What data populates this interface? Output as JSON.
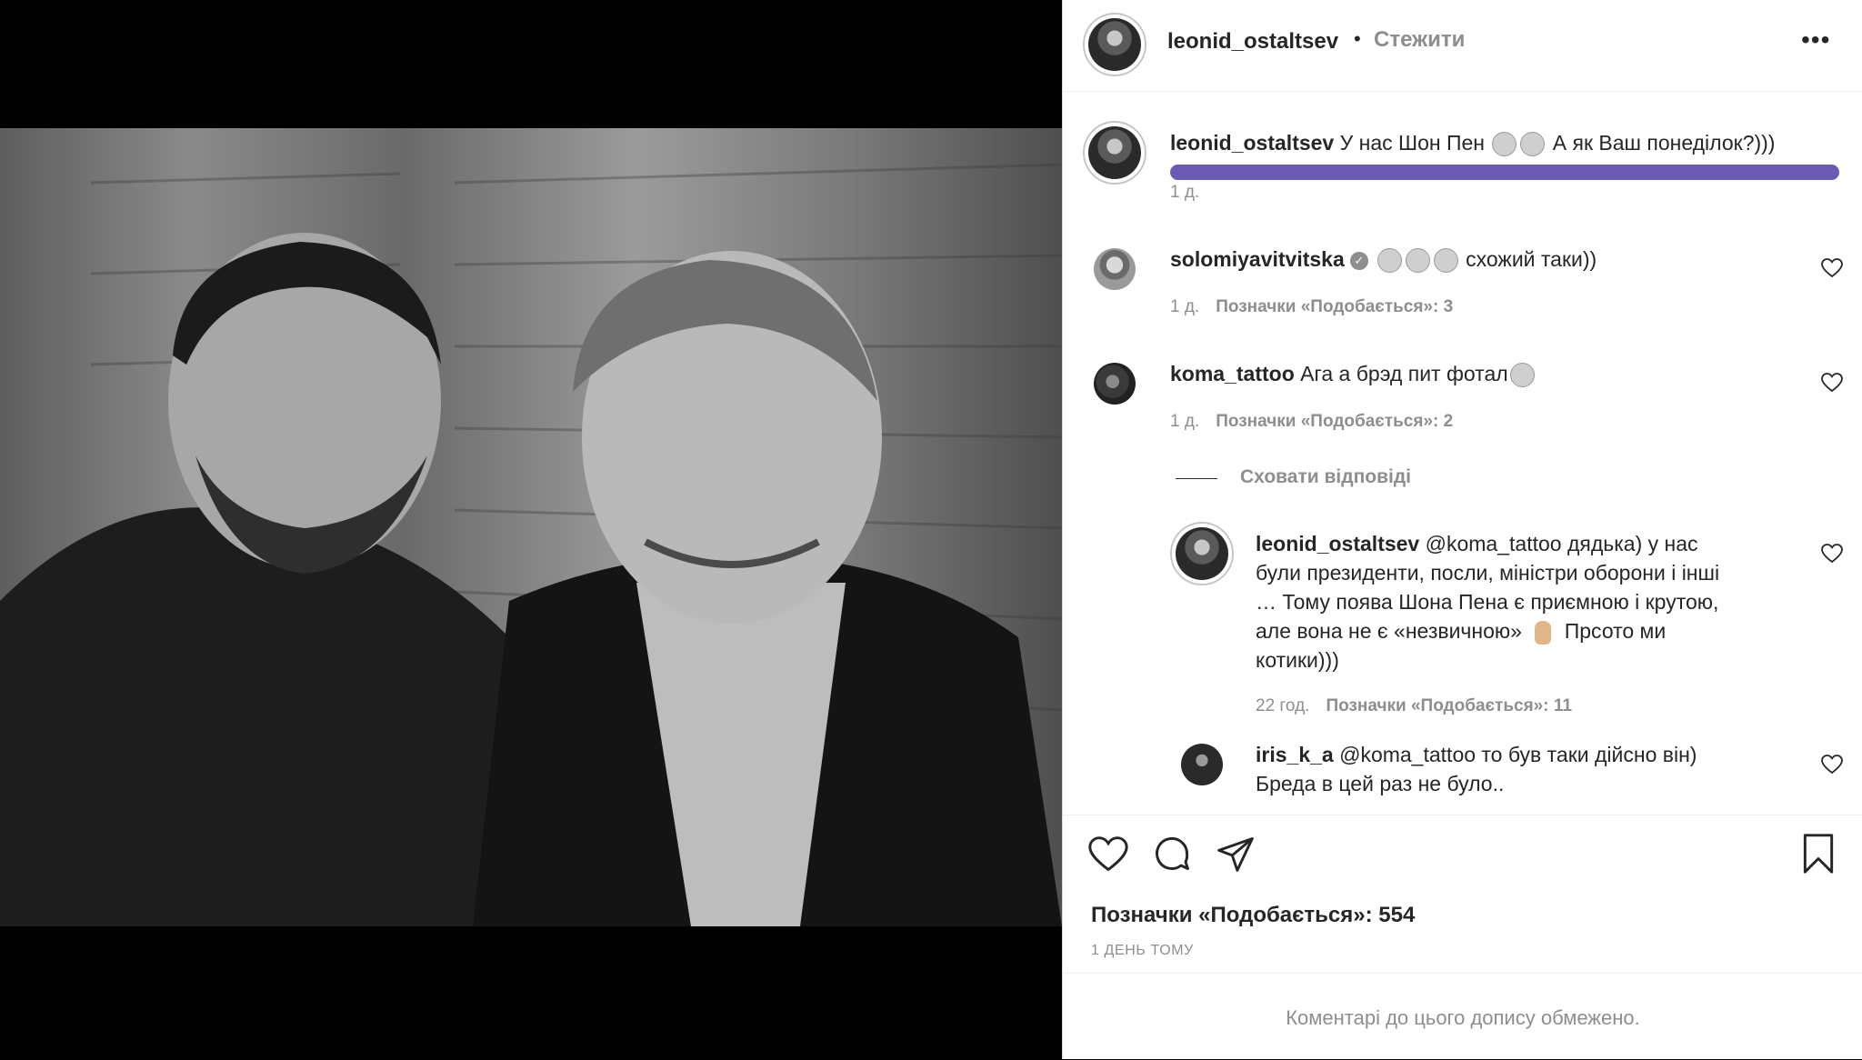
{
  "post": {
    "author": "leonid_ostaltsev",
    "follow_label": "Стежити",
    "separator": "•",
    "more_icon": "•••"
  },
  "caption": {
    "username": "leonid_ostaltsev",
    "text": "У нас Шон Пен",
    "text_after": "А як Ваш понеділок?)))",
    "time": "1 д.",
    "emojis": [
      "scream-emoji",
      "neutral-face-emoji"
    ]
  },
  "comments": [
    {
      "username": "solomiyavitvitska",
      "verified": true,
      "text": "схожий таки))",
      "emojis": [
        "laughing-emoji",
        "laughing-emoji",
        "laughing-emoji"
      ],
      "time": "1 д.",
      "likes": "Позначки «Подобається»: 3"
    },
    {
      "username": "koma_tattoo",
      "text": "Ага а брэд пит фотал",
      "emojis": [
        "grin-emoji"
      ],
      "time": "1 д.",
      "likes": "Позначки «Подобається»: 2"
    }
  ],
  "replies_toggle": "Сховати відповіді",
  "replies": [
    {
      "username": "leonid_ostaltsev",
      "line1": "@koma_tattoo дядька) у нас",
      "line2": "були президенти, посли, міністри оборони і інші",
      "line3": "… Тому поява Шона Пена є приємною і крутою,",
      "line4": "але вона не є «незвичною»",
      "line4_after": "Прсото ми",
      "line5": "котики)))",
      "time": "22 год.",
      "likes": "Позначки «Подобається»: 11"
    },
    {
      "username": "iris_k_a",
      "line1": "@koma_tattoo то був таки дійсно він)",
      "line2": "Бреда в цей раз не було.."
    }
  ],
  "footer": {
    "likes": "Позначки «Подобається»: 554",
    "time_ago": "1 ДЕНЬ ТОМУ",
    "comments_limited": "Коментарі до цього допису обмежено."
  },
  "colors": {
    "highlight": "#6a5ab1",
    "muted": "#8e8e8e",
    "text": "#262626"
  }
}
